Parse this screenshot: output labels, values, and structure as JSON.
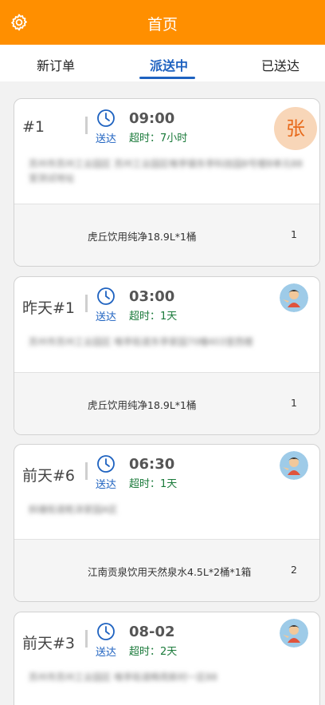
{
  "header": {
    "title": "首页"
  },
  "tabs": [
    {
      "label": "新订单"
    },
    {
      "label": "派送中"
    },
    {
      "label": "已送达"
    }
  ],
  "orders": [
    {
      "number": "#1",
      "delivery_label": "送达",
      "time": "09:00",
      "overdue": "超时：7小时",
      "address": "苏州市苏州工业园区 苏州工业园区唯亭镇东亭科技园8号楼B单元88室测试地址",
      "product": "虎丘饮用纯净18.9L*1桶",
      "quantity": "1",
      "courier_badge": "张"
    },
    {
      "number": "昨天#1",
      "delivery_label": "送达",
      "time": "03:00",
      "overdue": "超时：1天",
      "address": "苏州市苏州工业园区 唯亭街道东亭家园70幢403室西楼",
      "product": "虎丘饮用纯净18.9L*1桶",
      "quantity": "1"
    },
    {
      "number": "前天#6",
      "delivery_label": "送达",
      "time": "06:30",
      "overdue": "超时：1天",
      "address": "斜塘街道乾泽家园A区",
      "product": "江南贡泉饮用天然泉水4.5L*2桶*1箱",
      "quantity": "2"
    },
    {
      "number": "前天#3",
      "delivery_label": "送达",
      "time": "08-02",
      "overdue": "超时：2天",
      "address": "苏州市苏州工业园区 唯亭街道畅苑新村一区88",
      "product": "",
      "quantity": ""
    }
  ],
  "colors": {
    "accent": "#ff8f00",
    "tab_active": "#1e62c0",
    "overdue": "#1a7a3a"
  }
}
